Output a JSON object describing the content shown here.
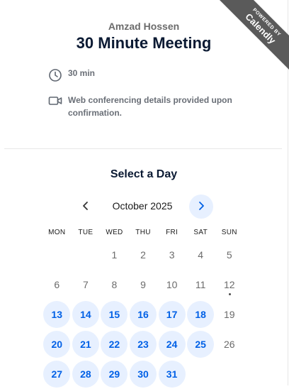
{
  "ribbon": {
    "powered_by": "POWERED BY",
    "brand": "Calendly"
  },
  "event": {
    "host": "Amzad Hossen",
    "title": "30 Minute Meeting",
    "duration": "30 min",
    "location": "Web conferencing details provided upon confirmation."
  },
  "calendar": {
    "select_label": "Select a Day",
    "month_label": "October 2025",
    "weekdays": [
      "MON",
      "TUE",
      "WED",
      "THU",
      "FRI",
      "SAT",
      "SUN"
    ],
    "weeks": [
      [
        {
          "day": "",
          "available": false
        },
        {
          "day": "",
          "available": false
        },
        {
          "day": "1",
          "available": false
        },
        {
          "day": "2",
          "available": false
        },
        {
          "day": "3",
          "available": false
        },
        {
          "day": "4",
          "available": false
        },
        {
          "day": "5",
          "available": false
        }
      ],
      [
        {
          "day": "6",
          "available": false
        },
        {
          "day": "7",
          "available": false
        },
        {
          "day": "8",
          "available": false
        },
        {
          "day": "9",
          "available": false
        },
        {
          "day": "10",
          "available": false
        },
        {
          "day": "11",
          "available": false
        },
        {
          "day": "12",
          "available": false,
          "today": true
        }
      ],
      [
        {
          "day": "13",
          "available": true
        },
        {
          "day": "14",
          "available": true
        },
        {
          "day": "15",
          "available": true
        },
        {
          "day": "16",
          "available": true
        },
        {
          "day": "17",
          "available": true
        },
        {
          "day": "18",
          "available": true
        },
        {
          "day": "19",
          "available": false
        }
      ],
      [
        {
          "day": "20",
          "available": true
        },
        {
          "day": "21",
          "available": true
        },
        {
          "day": "22",
          "available": true
        },
        {
          "day": "23",
          "available": true
        },
        {
          "day": "24",
          "available": true
        },
        {
          "day": "25",
          "available": true
        },
        {
          "day": "26",
          "available": false
        }
      ],
      [
        {
          "day": "27",
          "available": true
        },
        {
          "day": "28",
          "available": true
        },
        {
          "day": "29",
          "available": true
        },
        {
          "day": "30",
          "available": true
        },
        {
          "day": "31",
          "available": true
        },
        {
          "day": "",
          "available": false
        },
        {
          "day": "",
          "available": false
        }
      ]
    ]
  },
  "colors": {
    "accent": "#0060e6",
    "available_bg": "#e7f0ff",
    "ribbon_bg": "#5a5a5a"
  }
}
